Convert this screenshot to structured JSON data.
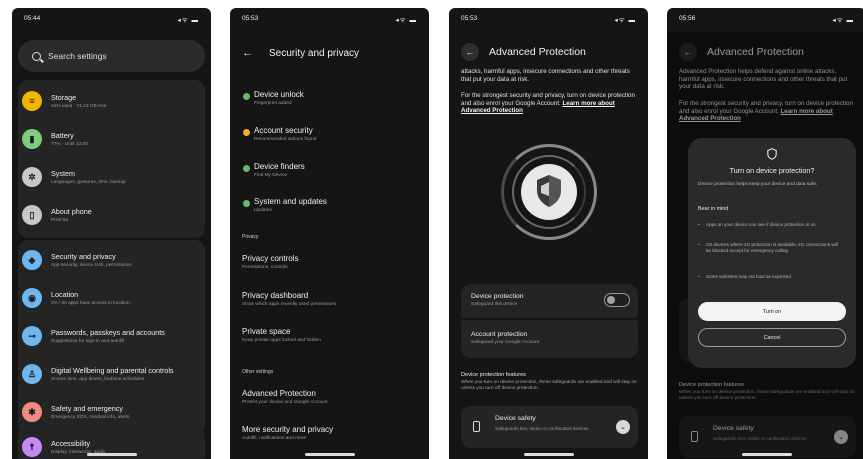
{
  "colors": {
    "storage": "#f4b400",
    "battery": "#7ccd7c",
    "system": "#c8c8c8",
    "about": "#c8c8c8",
    "security": "#6fb7ef",
    "location": "#6fb7ef",
    "passwords": "#6fb7ef",
    "wellbeing": "#6fb7ef",
    "safety": "#f28b82",
    "accessibility": "#c58af9",
    "ok": "#66bb6a",
    "warn": "#f2b01e"
  },
  "phone1": {
    "status": {
      "time": "05:44",
      "icons": "◂ᯤ ▬"
    },
    "search_placeholder": "Search settings",
    "items": [
      {
        "title": "Storage",
        "sub": "44% used · 71.23 GB free",
        "icon": "storage-icon",
        "glyph": "≡"
      },
      {
        "title": "Battery",
        "sub": "77% · Until 12:00",
        "icon": "battery-icon",
        "glyph": "▮"
      },
      {
        "title": "System",
        "sub": "Languages, gestures, time, backup",
        "icon": "gear-icon",
        "glyph": "✲"
      },
      {
        "title": "About phone",
        "sub": "Pixel 6a",
        "icon": "phone-icon",
        "glyph": "▯"
      },
      {
        "title": "Security and privacy",
        "sub": "App security, device lock, permissions",
        "icon": "shield-icon",
        "glyph": "◈"
      },
      {
        "title": "Location",
        "sub": "On / 30 apps have access to location",
        "icon": "location-icon",
        "glyph": "◉"
      },
      {
        "title": "Passwords, passkeys and accounts",
        "sub": "Suggestions for sign-in and autofill",
        "icon": "key-icon",
        "glyph": "⊸"
      },
      {
        "title": "Digital Wellbeing and parental controls",
        "sub": "Screen time, app timers, bedtime schedules",
        "icon": "wellbeing-icon",
        "glyph": "♙"
      },
      {
        "title": "Safety and emergency",
        "sub": "Emergency SOS, medical info, alerts",
        "icon": "asterisk-icon",
        "glyph": "✱"
      },
      {
        "title": "Accessibility",
        "sub": "Display, interaction, audio",
        "icon": "accessibility-icon",
        "glyph": "☨"
      }
    ]
  },
  "phone2": {
    "status": {
      "time": "05:53",
      "icons": "◂ᯤ ▬"
    },
    "title": "Security and privacy",
    "status_items": [
      {
        "title": "Device unlock",
        "sub": "Fingerprint added"
      },
      {
        "title": "Account security",
        "sub": "Recommended actions found"
      },
      {
        "title": "Device finders",
        "sub": "Find My Device"
      },
      {
        "title": "System and updates",
        "sub": "Updates"
      }
    ],
    "privacy_header": "Privacy",
    "privacy_items": [
      {
        "title": "Privacy controls",
        "sub": "Permissions, controls"
      },
      {
        "title": "Privacy dashboard",
        "sub": "Show which apps recently used permissions"
      },
      {
        "title": "Private space",
        "sub": "Keep private apps locked and hidden"
      }
    ],
    "other_header": "Other settings",
    "other_items": [
      {
        "title": "Advanced Protection",
        "sub": "Protect your device and Google Account"
      },
      {
        "title": "More security and privacy",
        "sub": "Autofill, notifications and more"
      }
    ]
  },
  "phone3": {
    "status": {
      "time": "05:53",
      "icons": "◂ᯤ ▬"
    },
    "title": "Advanced Protection",
    "intro_tail": "attacks, harmful apps, insecure connections and other threats that put your data at risk.",
    "para2": "For the strongest security and privacy, turn on device protection and also enrol your Google Account.",
    "learn_more": "Learn more about Advanced Protection",
    "device_protection": {
      "title": "Device protection",
      "sub": "Safeguard this device"
    },
    "account_protection": {
      "title": "Account protection",
      "sub": "Safeguard your Google Account"
    },
    "features_header": "Device protection features",
    "features_desc": "When you turn on device protection, these safeguards are enabled and will stay on unless you turn off device protection.",
    "feature_card": {
      "title": "Device safety",
      "sub": "Safeguards lost, stolen or confiscated devices"
    }
  },
  "phone4": {
    "status": {
      "time": "05:56",
      "icons": "◂ᯤ ▬"
    },
    "title": "Advanced Protection",
    "intro": "Advanced Protection helps defend against online attacks, harmful apps, insecure connections and other threats that put your data at risk.",
    "dialog": {
      "title": "Turn on device protection?",
      "desc": "Device protection helps keep your device and data safe.",
      "bear_header": "Bear in mind",
      "bullets": [
        "Apps on your device can see if device protection is on",
        "On devices where 2G protection is available, 2G connections will be blocked except for emergency calling",
        "Some websites may not load as expected"
      ],
      "turn_on": "Turn on",
      "cancel": "Cancel"
    },
    "features_header": "Device protection features",
    "features_desc": "When you turn on device protection, these safeguards are enabled and will stay on unless you turn off device protection.",
    "feature_card": {
      "title": "Device safety",
      "sub": "Safeguards lost, stolen or confiscated devices"
    }
  }
}
